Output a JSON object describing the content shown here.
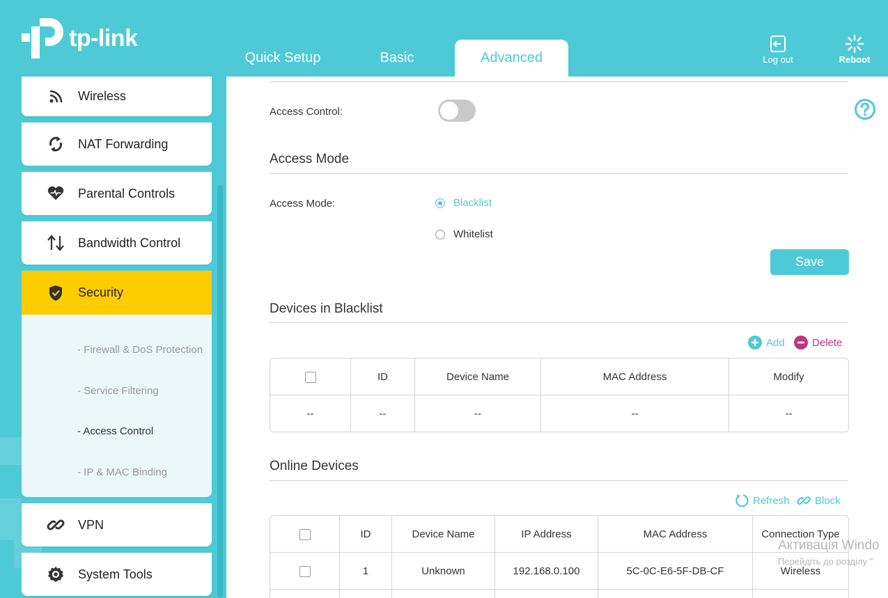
{
  "brand": {
    "logo_text": "tp-link"
  },
  "tabs": [
    {
      "label": "Quick Setup",
      "active": false
    },
    {
      "label": "Basic",
      "active": false
    },
    {
      "label": "Advanced",
      "active": true
    }
  ],
  "header_buttons": {
    "logout": "Log out",
    "reboot": "Reboot"
  },
  "sidebar": {
    "items": [
      {
        "label": "Wireless",
        "icon": "wifi-icon"
      },
      {
        "label": "NAT Forwarding",
        "icon": "nat-icon"
      },
      {
        "label": "Parental Controls",
        "icon": "heart-icon"
      },
      {
        "label": "Bandwidth Control",
        "icon": "updown-arrows-icon"
      },
      {
        "label": "Security",
        "icon": "shield-icon",
        "active": true
      },
      {
        "label": "VPN",
        "icon": "link-icon"
      },
      {
        "label": "System Tools",
        "icon": "gear-icon"
      }
    ],
    "security_sub": [
      {
        "label": "- Firewall & DoS Protection"
      },
      {
        "label": "- Service Filtering"
      },
      {
        "label": "- Access Control",
        "active": true
      },
      {
        "label": "- IP & MAC Binding"
      }
    ]
  },
  "access_control": {
    "label": "Access Control:",
    "enabled": false
  },
  "access_mode": {
    "section_title": "Access Mode",
    "label": "Access Mode:",
    "options": [
      {
        "label": "Blacklist",
        "selected": true
      },
      {
        "label": "Whitelist",
        "selected": false
      }
    ],
    "save_label": "Save"
  },
  "blacklist": {
    "section_title": "Devices in Blacklist",
    "add_label": "Add",
    "delete_label": "Delete",
    "columns": [
      "ID",
      "Device Name",
      "MAC Address",
      "Modify"
    ],
    "rows": [
      {
        "cb": "--",
        "id": "--",
        "name": "--",
        "mac": "--",
        "modify": "--"
      }
    ]
  },
  "online": {
    "section_title": "Online Devices",
    "refresh_label": "Refresh",
    "block_label": "Block",
    "columns": [
      "ID",
      "Device Name",
      "IP Address",
      "MAC Address",
      "Connection Type"
    ],
    "rows": [
      {
        "id": "1",
        "name": "Unknown",
        "ip": "192.168.0.100",
        "mac": "5C-0C-E6-5F-DB-CF",
        "type": "Wireless"
      }
    ]
  },
  "overlay": {
    "watermark_line1": "Активація Windo",
    "watermark_line2": "Перейдіть до розділу \""
  },
  "colors": {
    "accent": "#4ecad6",
    "active_nav": "#ffcc00",
    "delete": "#c0357a"
  }
}
